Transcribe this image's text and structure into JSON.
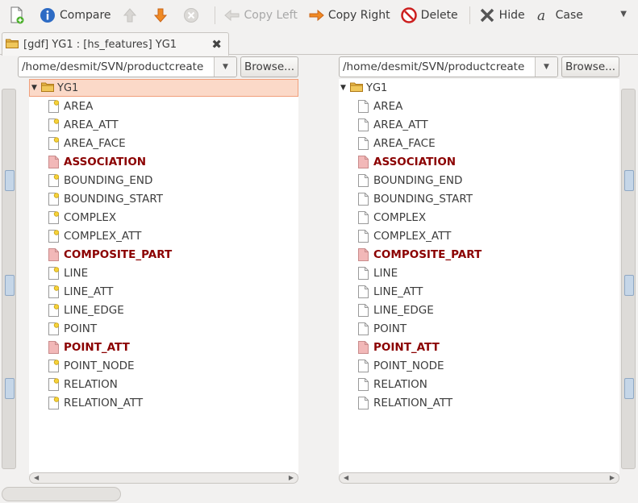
{
  "toolbar": {
    "new_icon": "new-comparison-icon",
    "compare_label": "Compare",
    "up_icon": "arrow-up-icon",
    "down_icon": "arrow-down-icon",
    "stop_icon": "stop-icon",
    "copy_left_label": "Copy Left",
    "copy_right_label": "Copy Right",
    "delete_label": "Delete",
    "hide_label": "Hide",
    "case_label": "Case",
    "menu_icon": "chevron-down-icon"
  },
  "tab": {
    "label": "[gdf] YG1 : [hs_features] YG1",
    "close_icon": "close-icon"
  },
  "left": {
    "path": "/home/desmit/SVN/productcreate",
    "browse_label": "Browse...",
    "root_label": "YG1",
    "items": [
      {
        "label": "AREA",
        "diff": false
      },
      {
        "label": "AREA_ATT",
        "diff": false
      },
      {
        "label": "AREA_FACE",
        "diff": false
      },
      {
        "label": "ASSOCIATION",
        "diff": true
      },
      {
        "label": "BOUNDING_END",
        "diff": false
      },
      {
        "label": "BOUNDING_START",
        "diff": false
      },
      {
        "label": "COMPLEX",
        "diff": false
      },
      {
        "label": "COMPLEX_ATT",
        "diff": false
      },
      {
        "label": "COMPOSITE_PART",
        "diff": true
      },
      {
        "label": "LINE",
        "diff": false
      },
      {
        "label": "LINE_ATT",
        "diff": false
      },
      {
        "label": "LINE_EDGE",
        "diff": false
      },
      {
        "label": "POINT",
        "diff": false
      },
      {
        "label": "POINT_ATT",
        "diff": true
      },
      {
        "label": "POINT_NODE",
        "diff": false
      },
      {
        "label": "RELATION",
        "diff": false
      },
      {
        "label": "RELATION_ATT",
        "diff": false
      }
    ]
  },
  "right": {
    "path": "/home/desmit/SVN/productcreate",
    "browse_label": "Browse...",
    "root_label": "YG1",
    "items": [
      {
        "label": "AREA",
        "diff": false
      },
      {
        "label": "AREA_ATT",
        "diff": false
      },
      {
        "label": "AREA_FACE",
        "diff": false
      },
      {
        "label": "ASSOCIATION",
        "diff": true
      },
      {
        "label": "BOUNDING_END",
        "diff": false
      },
      {
        "label": "BOUNDING_START",
        "diff": false
      },
      {
        "label": "COMPLEX",
        "diff": false
      },
      {
        "label": "COMPLEX_ATT",
        "diff": false
      },
      {
        "label": "COMPOSITE_PART",
        "diff": true
      },
      {
        "label": "LINE",
        "diff": false
      },
      {
        "label": "LINE_ATT",
        "diff": false
      },
      {
        "label": "LINE_EDGE",
        "diff": false
      },
      {
        "label": "POINT",
        "diff": false
      },
      {
        "label": "POINT_ATT",
        "diff": true
      },
      {
        "label": "POINT_NODE",
        "diff": false
      },
      {
        "label": "RELATION",
        "diff": false
      },
      {
        "label": "RELATION_ATT",
        "diff": false
      }
    ]
  },
  "colors": {
    "diff_text": "#8b0000",
    "diff_icon": "#f2b8b8",
    "selected_bg": "#fbd9c8",
    "gutter_mark": "#c5d6e8"
  }
}
